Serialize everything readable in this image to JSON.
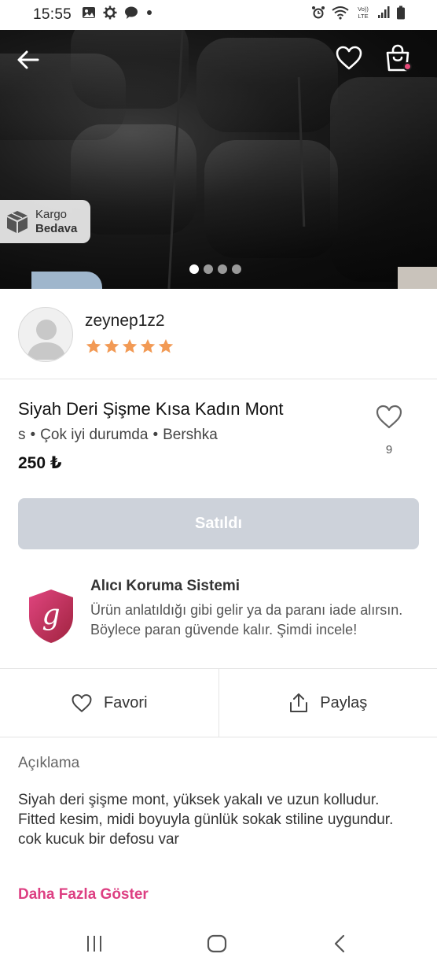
{
  "status_bar": {
    "time": "15:55",
    "left_icons": [
      "image-icon",
      "settings-icon",
      "chat-icon",
      "dot-icon"
    ],
    "right_icons": [
      "alarm-icon",
      "wifi-icon",
      "volte-icon",
      "signal-icon",
      "battery-icon"
    ],
    "volte_label": "Vo)) LTE"
  },
  "hero": {
    "image_count": 4,
    "active_index": 0,
    "shipping_badge": {
      "line1": "Kargo",
      "line2": "Bedava"
    },
    "icons": [
      "back-arrow-icon",
      "heart-icon",
      "shopping-bag-icon"
    ],
    "cart_dot_color": "#e84a79"
  },
  "seller": {
    "username": "zeynep1z2",
    "rating": 5,
    "star_color": "#f29a55"
  },
  "product": {
    "title": "Siyah Deri Şişme Kısa Kadın Mont",
    "size": "s",
    "separator": "•",
    "condition": "Çok iyi durumda",
    "brand": "Bershka",
    "price": "250 ₺",
    "like_count": "9"
  },
  "sold_button": {
    "label": "Satıldı",
    "color": "#cdd2da"
  },
  "protection": {
    "title": "Alıcı Koruma Sistemi",
    "text": "Ürün anlatıldığı gibi gelir ya da paranı iade alırsın. Böylece paran güvende kalır. Şimdi incele!",
    "shield_letter": "g",
    "gradient": [
      "#e0457f",
      "#a0233f"
    ]
  },
  "actions": {
    "favorite_label": "Favori",
    "share_label": "Paylaş"
  },
  "description": {
    "heading": "Açıklama",
    "body": "Siyah deri şişme mont, yüksek yakalı ve uzun kolludur. Fitted kesim, midi boyuyla günlük sokak stiline uygundur. cok kucuk bir defosu var",
    "more_label": "Daha Fazla Göster",
    "accent": "#dd3f82"
  },
  "nav_bar": {
    "icons": [
      "recents-icon",
      "home-icon",
      "back-icon"
    ]
  }
}
